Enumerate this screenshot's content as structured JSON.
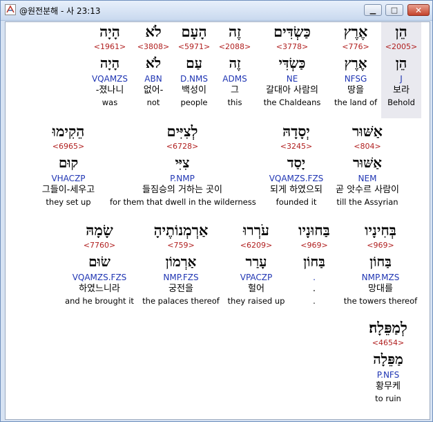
{
  "window": {
    "title": "@원전분해 - 사 23:13",
    "minimize_glyph": "▁",
    "maximize_glyph": "□",
    "close_glyph": "✕"
  },
  "rows": [
    {
      "words": [
        {
          "hebrew": "הֵן",
          "strong": "<2005>",
          "lemma": "הֵן",
          "parse": "J",
          "korean": "보라",
          "english": "Behold",
          "highlighted": true
        },
        {
          "hebrew": "אֶרֶץ",
          "strong": "<776>",
          "lemma": "אֶרֶץ",
          "parse": "NFSG",
          "korean": "땅을",
          "english": "the land of"
        },
        {
          "hebrew": "כַּשְׂדִּים",
          "strong": "<3778>",
          "lemma": "כַּשְׂדִּי",
          "parse": "NE",
          "korean": "갈대아 사람의",
          "english": "the Chaldeans"
        },
        {
          "hebrew": "זֶה",
          "strong": "<2088>",
          "lemma": "זֶה",
          "parse": "ADMS",
          "korean": "그",
          "english": "this"
        },
        {
          "hebrew": "הָעָם",
          "strong": "<5971>",
          "lemma": "עַם",
          "parse": "D.NMS",
          "korean": "백성이",
          "english": "people"
        },
        {
          "hebrew": "לֹא",
          "strong": "<3808>",
          "lemma": "לֹא",
          "parse": "ABN",
          "korean": "없어-",
          "english": "not"
        },
        {
          "hebrew": "הָיָה",
          "strong": "<1961>",
          "lemma": "הָיָה",
          "parse": "VQAMZS",
          "korean": "-졌나니",
          "english": "was"
        }
      ]
    },
    {
      "words": [
        {
          "hebrew": "אַשּׁוּר",
          "strong": "<804>",
          "lemma": "אַשּׁוּר",
          "parse": "NEM",
          "korean": "곧 앗수르 사람이",
          "english": "till the Assyrian"
        },
        {
          "hebrew": "יְסָדָהּ",
          "strong": "<3245>",
          "lemma": "יָסַד",
          "parse": "VQAMZS.FZS",
          "korean": "되게 하였으되",
          "english": "founded it"
        },
        {
          "hebrew": "לְצִיִּים",
          "strong": "<6728>",
          "lemma": "צִיִּי",
          "parse": "P.NMP",
          "korean": "들짐승의 거하는 곳이",
          "english": "for them that dwell in the wilderness"
        },
        {
          "hebrew": "הֵקִימוּ",
          "strong": "<6965>",
          "lemma": "קוּם",
          "parse": "VHACZP",
          "korean": "그들이-세우고",
          "english": "they set up"
        }
      ]
    },
    {
      "words": [
        {
          "hebrew": "בְּחִינָיו",
          "strong": "<969>",
          "lemma": "בַּחוֹן",
          "parse": "NMP.MZS",
          "korean": "망대를",
          "english": "the towers thereof"
        },
        {
          "hebrew": "בַּחוּנָיו",
          "strong": "<969>",
          "lemma": "בַּחוֹן",
          "parse": ".",
          "korean": ".",
          "english": "."
        },
        {
          "hebrew": "עֹרְרוּ",
          "strong": "<6209>",
          "lemma": "עָרַר",
          "parse": "VPACZP",
          "korean": "헐어",
          "english": "they raised up"
        },
        {
          "hebrew": "אַרְמְנוֹתֶיהָ",
          "strong": "<759>",
          "lemma": "אַרְמוֹן",
          "parse": "NMP.FZS",
          "korean": "궁전을",
          "english": "the palaces thereof"
        },
        {
          "hebrew": "שָׂמָהּ",
          "strong": "<7760>",
          "lemma": "שׂוּם",
          "parse": "VQAMZS.FZS",
          "korean": "하였느니라",
          "english": "and he brought it"
        }
      ]
    },
    {
      "words": [
        {
          "hebrew": "לְמַפֵּלָה׃",
          "strong": "<4654>",
          "lemma": "מַפֵּלָה",
          "parse": "P.NFS",
          "korean": "황무케",
          "english": "to ruin"
        }
      ]
    }
  ]
}
